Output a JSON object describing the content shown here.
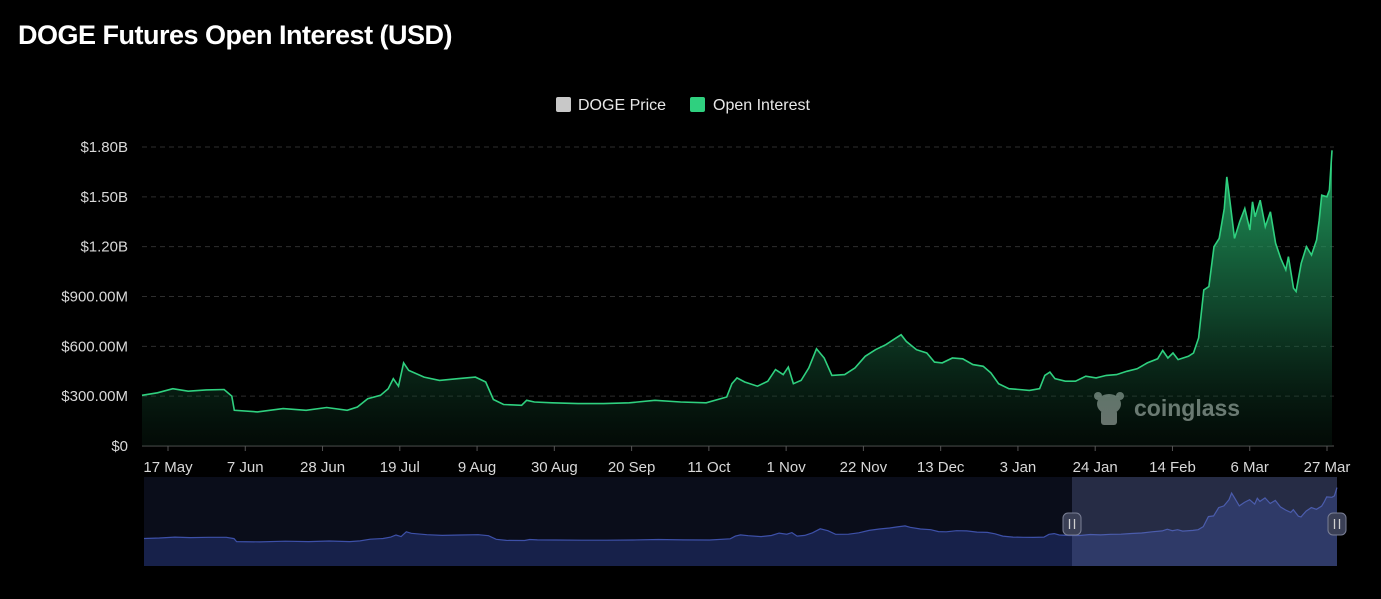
{
  "page": {
    "title": "DOGE Futures Open Interest (USD)",
    "watermark": "coinglass"
  },
  "colors": {
    "background": "#000000",
    "open_interest_line": "#2fd07f",
    "open_interest_fill": "#27c073",
    "price_legend": "#c8c8c8",
    "navigator_line": "#3d50a8",
    "navigator_fill": "#17214a",
    "navigator_window": "#6f7fb8",
    "grid": "#2e2e2e"
  },
  "chart_data": {
    "type": "area",
    "title": "DOGE Futures Open Interest (USD)",
    "legend": {
      "placement": "top-center",
      "items": [
        "DOGE Price",
        "Open Interest"
      ]
    },
    "grid": {
      "horizontal": true,
      "style": "dashed",
      "vertical": false
    },
    "x_tick_labels": [
      "17 May",
      "7 Jun",
      "28 Jun",
      "19 Jul",
      "9 Aug",
      "30 Aug",
      "20 Sep",
      "11 Oct",
      "1 Nov",
      "22 Nov",
      "13 Dec",
      "3 Jan",
      "24 Jan",
      "14 Feb",
      "6 Mar",
      "27 Mar"
    ],
    "y_tick_labels": [
      "$0",
      "$300.00M",
      "$600.00M",
      "$900.00M",
      "$1.20B",
      "$1.50B",
      "$1.80B"
    ],
    "y_ticks": [
      0,
      300,
      600,
      900,
      1200,
      1500,
      1800
    ],
    "ylim": [
      0,
      1800
    ],
    "y_unit": "USD millions",
    "series": [
      {
        "name": "Open Interest",
        "points": [
          [
            0,
            305
          ],
          [
            6,
            320
          ],
          [
            12,
            345
          ],
          [
            18,
            330
          ],
          [
            25,
            338
          ],
          [
            32,
            340
          ],
          [
            35,
            300
          ],
          [
            36,
            215
          ],
          [
            45,
            205
          ],
          [
            55,
            225
          ],
          [
            64,
            215
          ],
          [
            72,
            232
          ],
          [
            80,
            215
          ],
          [
            84,
            235
          ],
          [
            88,
            285
          ],
          [
            93,
            305
          ],
          [
            96,
            345
          ],
          [
            98,
            405
          ],
          [
            100,
            360
          ],
          [
            102,
            500
          ],
          [
            104,
            455
          ],
          [
            110,
            415
          ],
          [
            116,
            395
          ],
          [
            123,
            405
          ],
          [
            130,
            415
          ],
          [
            134,
            385
          ],
          [
            137,
            280
          ],
          [
            141,
            250
          ],
          [
            148,
            245
          ],
          [
            150,
            275
          ],
          [
            153,
            265
          ],
          [
            160,
            260
          ],
          [
            170,
            255
          ],
          [
            180,
            255
          ],
          [
            190,
            260
          ],
          [
            200,
            275
          ],
          [
            210,
            265
          ],
          [
            220,
            260
          ],
          [
            228,
            295
          ],
          [
            230,
            375
          ],
          [
            232,
            410
          ],
          [
            235,
            385
          ],
          [
            240,
            360
          ],
          [
            244,
            390
          ],
          [
            247,
            460
          ],
          [
            250,
            430
          ],
          [
            252,
            475
          ],
          [
            254,
            375
          ],
          [
            257,
            395
          ],
          [
            260,
            470
          ],
          [
            263,
            585
          ],
          [
            266,
            530
          ],
          [
            269,
            425
          ],
          [
            274,
            430
          ],
          [
            278,
            470
          ],
          [
            282,
            540
          ],
          [
            286,
            580
          ],
          [
            290,
            610
          ],
          [
            293,
            640
          ],
          [
            296,
            670
          ],
          [
            298,
            630
          ],
          [
            302,
            580
          ],
          [
            306,
            560
          ],
          [
            309,
            505
          ],
          [
            312,
            500
          ],
          [
            316,
            530
          ],
          [
            320,
            525
          ],
          [
            324,
            490
          ],
          [
            328,
            480
          ],
          [
            331,
            440
          ],
          [
            334,
            375
          ],
          [
            338,
            345
          ],
          [
            342,
            340
          ],
          [
            346,
            335
          ],
          [
            350,
            345
          ],
          [
            352,
            425
          ],
          [
            354,
            445
          ],
          [
            356,
            405
          ],
          [
            360,
            390
          ],
          [
            364,
            390
          ],
          [
            368,
            420
          ],
          [
            372,
            410
          ],
          [
            376,
            425
          ],
          [
            380,
            430
          ],
          [
            384,
            450
          ],
          [
            388,
            465
          ],
          [
            392,
            500
          ],
          [
            396,
            525
          ],
          [
            398,
            575
          ],
          [
            400,
            530
          ],
          [
            402,
            560
          ],
          [
            404,
            520
          ],
          [
            408,
            540
          ],
          [
            410,
            560
          ],
          [
            412,
            650
          ],
          [
            414,
            940
          ],
          [
            416,
            960
          ],
          [
            418,
            1200
          ],
          [
            420,
            1250
          ],
          [
            422,
            1430
          ],
          [
            423,
            1620
          ],
          [
            424,
            1500
          ],
          [
            426,
            1250
          ],
          [
            428,
            1350
          ],
          [
            430,
            1430
          ],
          [
            432,
            1300
          ],
          [
            433,
            1470
          ],
          [
            434,
            1380
          ],
          [
            436,
            1480
          ],
          [
            438,
            1320
          ],
          [
            440,
            1410
          ],
          [
            442,
            1220
          ],
          [
            444,
            1130
          ],
          [
            446,
            1060
          ],
          [
            447,
            1140
          ],
          [
            449,
            950
          ],
          [
            450,
            930
          ],
          [
            452,
            1100
          ],
          [
            454,
            1200
          ],
          [
            456,
            1150
          ],
          [
            458,
            1240
          ],
          [
            459,
            1360
          ],
          [
            460,
            1510
          ],
          [
            462,
            1500
          ],
          [
            463,
            1540
          ],
          [
            464,
            1780
          ]
        ]
      }
    ],
    "x_domain": [
      0,
      464
    ],
    "navigator": {
      "series_name": "DOGE Price",
      "selected_range": "24 Jan – 27 Mar"
    }
  }
}
